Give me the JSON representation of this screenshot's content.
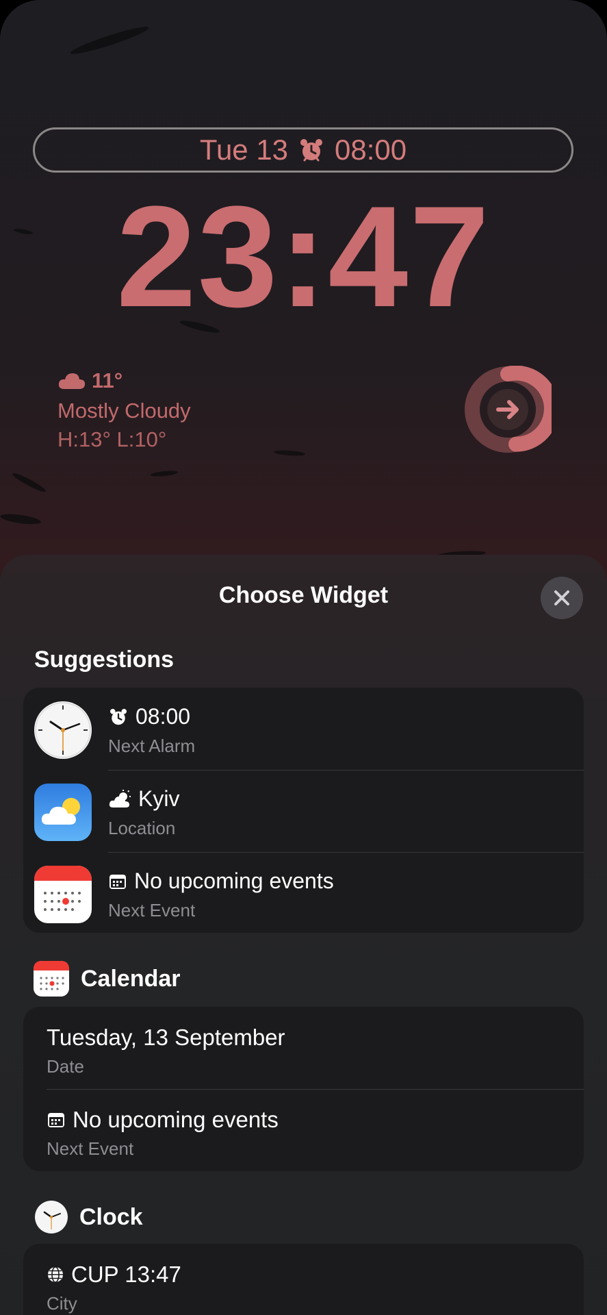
{
  "lockscreen": {
    "date_widget": {
      "date": "Tue 13",
      "alarm_time": "08:00"
    },
    "time": "23:47",
    "weather": {
      "temp": "11°",
      "condition": "Mostly Cloudy",
      "range": "H:13° L:10°"
    }
  },
  "sheet": {
    "title": "Choose Widget",
    "suggestions_label": "Suggestions",
    "suggestions": [
      {
        "title": "08:00",
        "subtitle": "Next Alarm",
        "icon": "clock-app-icon"
      },
      {
        "title": "Kyiv",
        "subtitle": "Location",
        "icon": "weather-app-icon"
      },
      {
        "title": "No upcoming events",
        "subtitle": "Next Event",
        "icon": "calendar-app-icon"
      }
    ],
    "calendar_label": "Calendar",
    "calendar_items": [
      {
        "title": "Tuesday, 13 September",
        "subtitle": "Date"
      },
      {
        "title": "No upcoming events",
        "subtitle": "Next Event"
      }
    ],
    "clock_label": "Clock",
    "clock_items": [
      {
        "title": "CUP 13:47",
        "subtitle": "City"
      }
    ]
  },
  "colors": {
    "accent": "#c96d70",
    "sheet_bg": "#242527",
    "card_bg": "#1b1b1d",
    "secondary_text": "#8e8e93"
  }
}
